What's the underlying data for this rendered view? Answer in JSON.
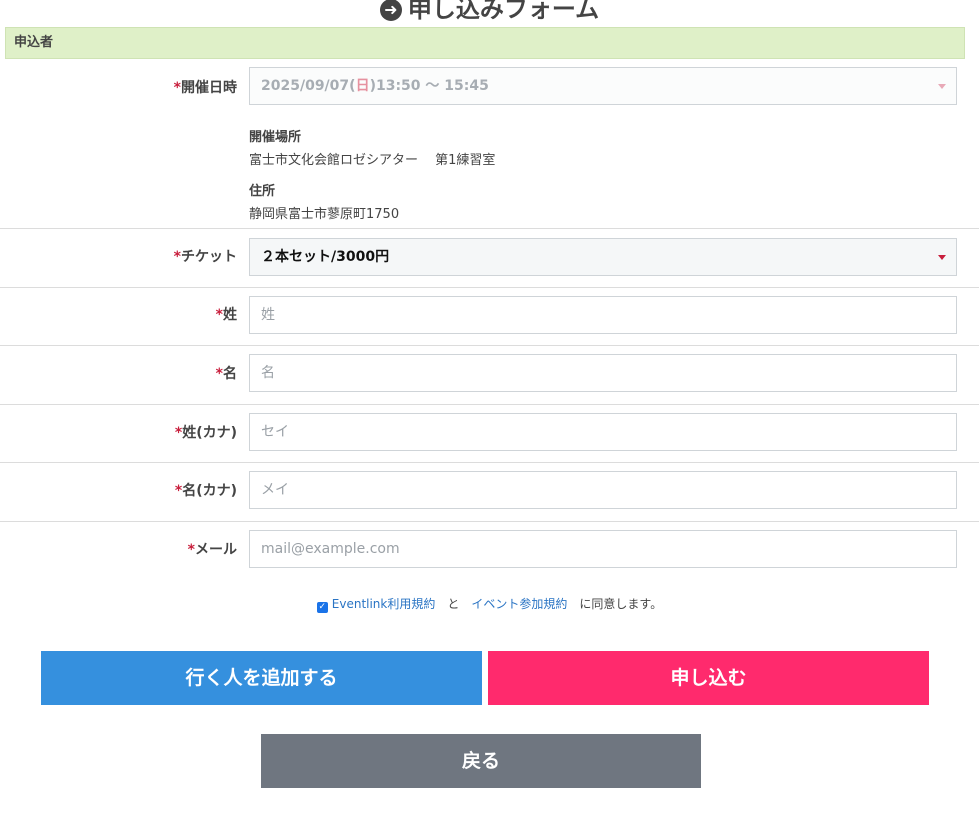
{
  "page": {
    "title": "申し込みフォーム"
  },
  "section": {
    "header": "申込者"
  },
  "form": {
    "required_mark": "*",
    "event_date": {
      "label": "開催日時",
      "date_prefix": "2025/09/07(",
      "weekday": "日",
      "date_suffix": ")13:50 ～ 15:45"
    },
    "venue": {
      "place_label": "開催場所",
      "place_value": "富士市文化会館ロゼシアター　 第1練習室",
      "address_label": "住所",
      "address_value": "静岡県富士市蓼原町1750"
    },
    "ticket": {
      "label": "チケット",
      "value": "２本セット/3000円"
    },
    "last_name": {
      "label": "姓",
      "placeholder": "姓"
    },
    "first_name": {
      "label": "名",
      "placeholder": "名"
    },
    "last_name_kana": {
      "label": "姓(カナ)",
      "placeholder": "セイ"
    },
    "first_name_kana": {
      "label": "名(カナ)",
      "placeholder": "メイ"
    },
    "email": {
      "label": "メール",
      "placeholder": "mail@example.com"
    }
  },
  "agreement": {
    "checked": true,
    "terms_link": "Eventlink利用規約",
    "connector": "と",
    "event_terms_link": "イベント参加規約",
    "suffix": "に同意します。"
  },
  "buttons": {
    "add_person": "行く人を追加する",
    "apply": "申し込む",
    "back": "戻る"
  },
  "colors": {
    "section_bg": "#dff0c8",
    "required": "#c81e3c",
    "btn_blue": "#3590de",
    "btn_pink": "#ff2a6d",
    "btn_gray": "#6f7680",
    "link": "#2a74c4"
  }
}
